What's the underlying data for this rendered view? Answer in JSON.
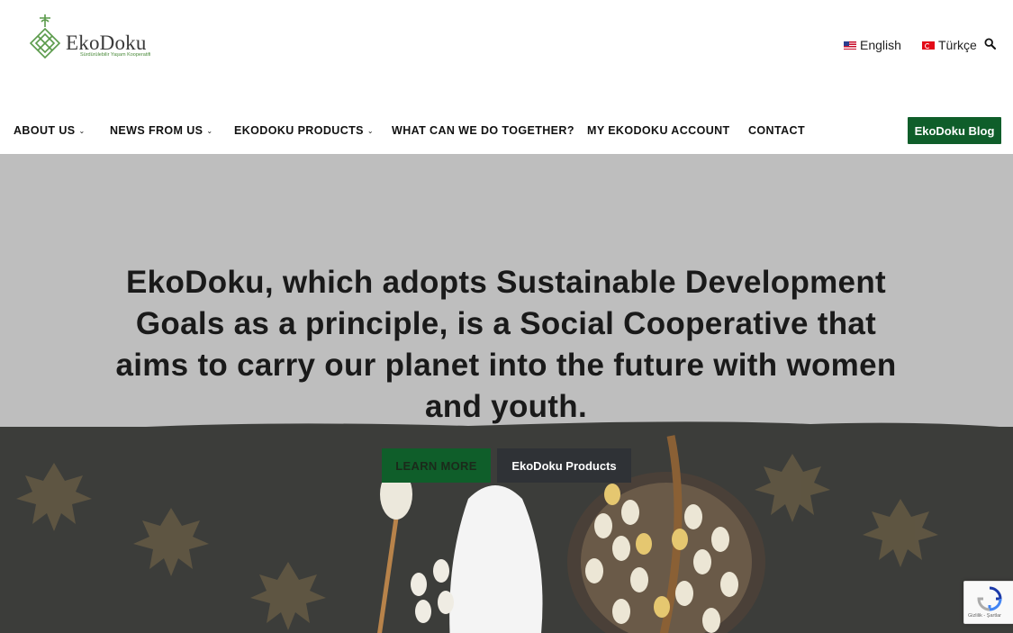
{
  "header": {
    "logo_text": "EkoDoku",
    "logo_tagline": "Sürdürülebilir Yaşam Kooperatifi",
    "languages": [
      {
        "label": "English",
        "flag": "us-flag-icon"
      },
      {
        "label": "Türkçe",
        "flag": "tr-flag-icon"
      }
    ],
    "search_icon": "search-icon"
  },
  "nav": {
    "items": [
      {
        "label": "ABOUT US",
        "has_dropdown": true
      },
      {
        "label": "NEWS FROM US",
        "has_dropdown": true
      },
      {
        "label": "EKODOKU PRODUCTS",
        "has_dropdown": true
      },
      {
        "label": "WHAT CAN WE DO TOGETHER?",
        "has_dropdown": false
      },
      {
        "label": "MY EKODOKU ACCOUNT",
        "has_dropdown": false
      },
      {
        "label": "CONTACT",
        "has_dropdown": false
      }
    ],
    "blog_button": "EkoDoku Blog",
    "chevron": "⌄"
  },
  "hero": {
    "headline": "EkoDoku, which adopts Sustainable Development Goals as a principle, is a Social Cooperative that aims to carry our planet into the future with women and youth.",
    "learn_more": "LEARN MORE",
    "products_button": "EkoDoku Products"
  },
  "recaptcha": {
    "footer": "Gizlilik - Şartlar"
  },
  "colors": {
    "brand_green": "#0f5e2a",
    "dark_button": "#2f3236",
    "hero_background": "#bebebe"
  }
}
